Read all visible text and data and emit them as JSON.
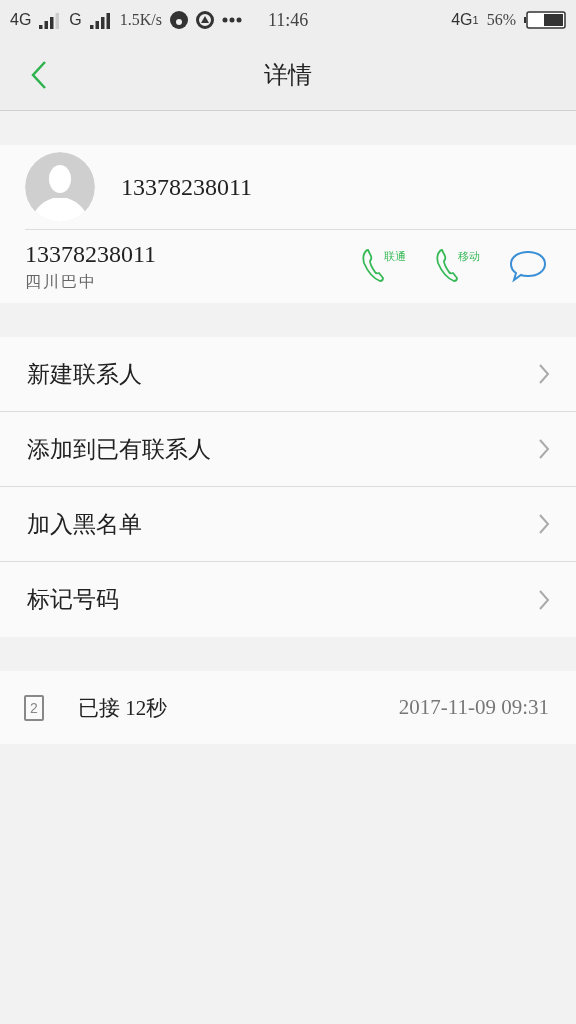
{
  "status_bar": {
    "network_1": "4G",
    "network_2": "G",
    "speed": "1.5K/s",
    "time": "11:46",
    "network_3": "4G",
    "sim_index": "1",
    "battery_percent": "56%"
  },
  "header": {
    "title": "详情"
  },
  "contact": {
    "name": "13378238011",
    "number": "13378238011",
    "location": "四川巴中",
    "call_buttons": [
      {
        "label": "联通"
      },
      {
        "label": "移动"
      }
    ]
  },
  "actions": [
    {
      "label": "新建联系人"
    },
    {
      "label": "添加到已有联系人"
    },
    {
      "label": "加入黑名单"
    },
    {
      "label": "标记号码"
    }
  ],
  "call_log": [
    {
      "sim": "2",
      "status": "已接 12秒",
      "time": "2017-11-09 09:31"
    }
  ]
}
